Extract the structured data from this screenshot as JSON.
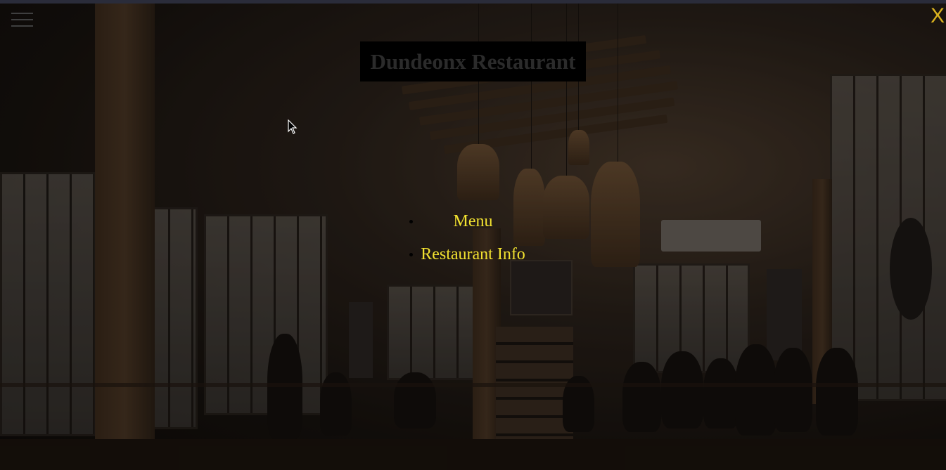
{
  "header": {
    "title": "Dundeonx Restaurant",
    "close_label": "X"
  },
  "menu_button": {
    "icon": "hamburger-menu-icon"
  },
  "nav": {
    "items": [
      {
        "label": "Menu"
      },
      {
        "label": "Restaurant Info"
      }
    ]
  },
  "colors": {
    "accent": "#f2e230",
    "close": "#d9b21f",
    "title_text": "#2b2b2b",
    "title_bg": "#000000"
  }
}
